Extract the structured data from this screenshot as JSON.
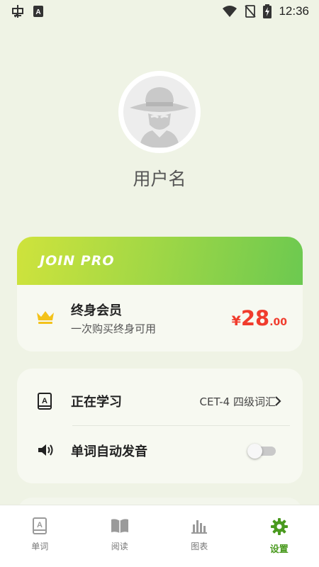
{
  "status_bar": {
    "time": "12:36",
    "icons": [
      "debug-icon",
      "keyboard-a-icon",
      "wifi-icon",
      "no-signal-icon",
      "battery-charging-icon"
    ]
  },
  "profile": {
    "avatar_icon": "incognito-hat-icon",
    "username": "用户名"
  },
  "pro_card": {
    "banner_text": "JOIN PRO",
    "crown_icon": "crown-icon",
    "title": "终身会员",
    "subtitle": "一次购买终身可用",
    "price_symbol": "¥",
    "price_integer": "28",
    "price_decimal": ".00",
    "colors": {
      "price": "#f03c2d",
      "crown": "#f3c21a",
      "banner_start": "#cfe33c",
      "banner_end": "#6cc950"
    }
  },
  "settings": {
    "learning": {
      "icon": "book-a-icon",
      "label": "正在学习",
      "value": "CET-4 四级词汇"
    },
    "auto_pronounce": {
      "icon": "speaker-icon",
      "label": "单词自动发音",
      "enabled": false
    }
  },
  "bottom_nav": {
    "items": [
      {
        "icon": "word-book-icon",
        "label": "单词",
        "active": false
      },
      {
        "icon": "open-book-icon",
        "label": "阅读",
        "active": false
      },
      {
        "icon": "bar-chart-icon",
        "label": "图表",
        "active": false
      },
      {
        "icon": "gear-icon",
        "label": "设置",
        "active": true
      }
    ],
    "active_color": "#4a9a1f"
  }
}
